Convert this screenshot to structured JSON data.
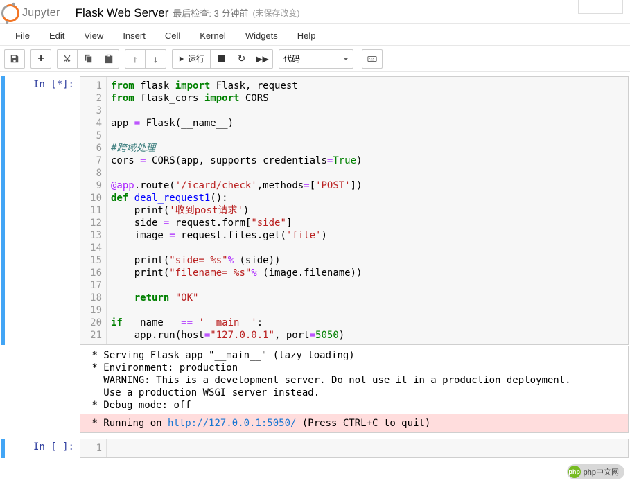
{
  "header": {
    "logo_text": "Jupyter",
    "title": "Flask Web Server",
    "last_checkpoint": "最后检查: 3 分钟前",
    "autosave": "(未保存改变)"
  },
  "menu": {
    "file": "File",
    "edit": "Edit",
    "view": "View",
    "insert": "Insert",
    "cell": "Cell",
    "kernel": "Kernel",
    "widgets": "Widgets",
    "help": "Help"
  },
  "toolbar": {
    "run_label": "运行",
    "celltype_selected": "代码"
  },
  "cell1": {
    "prompt": "In [*]:",
    "line_count": 21,
    "code": {
      "l1": {
        "kw1": "from",
        "nm1": " flask ",
        "kw2": "import",
        "nm2": " Flask, request"
      },
      "l2": {
        "kw1": "from",
        "nm1": " flask_cors ",
        "kw2": "import",
        "nm2": " CORS"
      },
      "l4a": "app ",
      "l4op": "=",
      "l4b": " Flask(__name__)",
      "l6": "#跨域处理",
      "l7a": "cors ",
      "l7op1": "=",
      "l7b": " CORS(app, supports_credentials",
      "l7op2": "=",
      "l7true": "True",
      "l7c": ")",
      "l9dec": "@app",
      "l9a": ".route(",
      "l9s1": "'/icard/check'",
      "l9b": ",methods",
      "l9op": "=",
      "l9c": "[",
      "l9s2": "'POST'",
      "l9d": "])",
      "l10kw": "def",
      "l10sp": " ",
      "l10fn": "deal_request1",
      "l10b": "():",
      "l11a": "    print(",
      "l11s": "'收到post请求'",
      "l11b": ")",
      "l12a": "    side ",
      "l12op": "=",
      "l12b": " request.form[",
      "l12s": "\"side\"",
      "l12c": "]",
      "l13a": "    image ",
      "l13op": "=",
      "l13b": " request.files.get(",
      "l13s": "'file'",
      "l13c": ")",
      "l15a": "    print(",
      "l15s": "\"side= %s\"",
      "l15op": "%",
      "l15b": " (side))",
      "l16a": "    print(",
      "l16s": "\"filename= %s\"",
      "l16op": "%",
      "l16b": " (image.filename))",
      "l18kw": "    return",
      "l18sp": " ",
      "l18s": "\"OK\"",
      "l20kw": "if",
      "l20a": " __name__ ",
      "l20op": "==",
      "l20sp": " ",
      "l20s": "'__main__'",
      "l20b": ":",
      "l21a": "    app.run(host",
      "l21op1": "=",
      "l21s": "\"127.0.0.1\"",
      "l21b": ", port",
      "l21op2": "=",
      "l21num": "5050",
      "l21c": ")"
    },
    "output_stdout": " * Serving Flask app \"__main__\" (lazy loading)\n * Environment: production\n   WARNING: This is a development server. Do not use it in a production deployment.\n   Use a production WSGI server instead.\n * Debug mode: off",
    "output_stderr_pre": " * Running on ",
    "output_stderr_url": "http://127.0.0.1:5050/",
    "output_stderr_post": " (Press CTRL+C to quit)"
  },
  "cell2": {
    "prompt": "In [ ]:"
  },
  "watermark": {
    "logo": "php",
    "text": "php中文网"
  }
}
